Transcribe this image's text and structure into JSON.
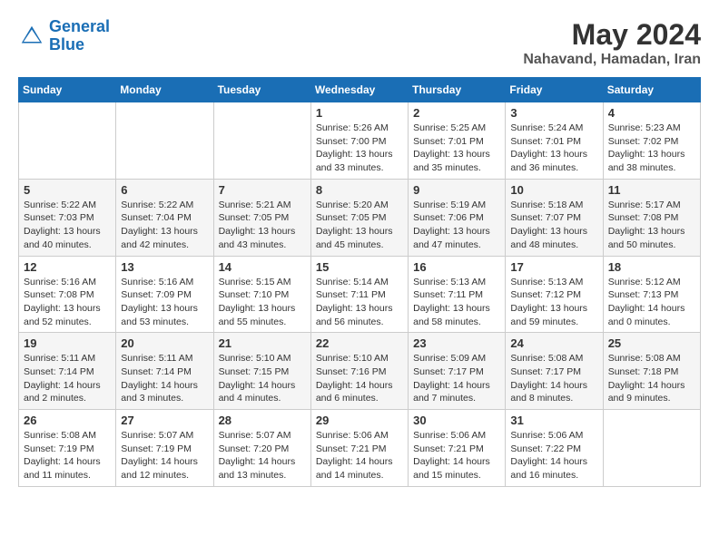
{
  "logo": {
    "line1": "General",
    "line2": "Blue"
  },
  "title": "May 2024",
  "location": "Nahavand, Hamadan, Iran",
  "days_of_week": [
    "Sunday",
    "Monday",
    "Tuesday",
    "Wednesday",
    "Thursday",
    "Friday",
    "Saturday"
  ],
  "weeks": [
    [
      {
        "day": "",
        "info": ""
      },
      {
        "day": "",
        "info": ""
      },
      {
        "day": "",
        "info": ""
      },
      {
        "day": "1",
        "info": "Sunrise: 5:26 AM\nSunset: 7:00 PM\nDaylight: 13 hours\nand 33 minutes."
      },
      {
        "day": "2",
        "info": "Sunrise: 5:25 AM\nSunset: 7:01 PM\nDaylight: 13 hours\nand 35 minutes."
      },
      {
        "day": "3",
        "info": "Sunrise: 5:24 AM\nSunset: 7:01 PM\nDaylight: 13 hours\nand 36 minutes."
      },
      {
        "day": "4",
        "info": "Sunrise: 5:23 AM\nSunset: 7:02 PM\nDaylight: 13 hours\nand 38 minutes."
      }
    ],
    [
      {
        "day": "5",
        "info": "Sunrise: 5:22 AM\nSunset: 7:03 PM\nDaylight: 13 hours\nand 40 minutes."
      },
      {
        "day": "6",
        "info": "Sunrise: 5:22 AM\nSunset: 7:04 PM\nDaylight: 13 hours\nand 42 minutes."
      },
      {
        "day": "7",
        "info": "Sunrise: 5:21 AM\nSunset: 7:05 PM\nDaylight: 13 hours\nand 43 minutes."
      },
      {
        "day": "8",
        "info": "Sunrise: 5:20 AM\nSunset: 7:05 PM\nDaylight: 13 hours\nand 45 minutes."
      },
      {
        "day": "9",
        "info": "Sunrise: 5:19 AM\nSunset: 7:06 PM\nDaylight: 13 hours\nand 47 minutes."
      },
      {
        "day": "10",
        "info": "Sunrise: 5:18 AM\nSunset: 7:07 PM\nDaylight: 13 hours\nand 48 minutes."
      },
      {
        "day": "11",
        "info": "Sunrise: 5:17 AM\nSunset: 7:08 PM\nDaylight: 13 hours\nand 50 minutes."
      }
    ],
    [
      {
        "day": "12",
        "info": "Sunrise: 5:16 AM\nSunset: 7:08 PM\nDaylight: 13 hours\nand 52 minutes."
      },
      {
        "day": "13",
        "info": "Sunrise: 5:16 AM\nSunset: 7:09 PM\nDaylight: 13 hours\nand 53 minutes."
      },
      {
        "day": "14",
        "info": "Sunrise: 5:15 AM\nSunset: 7:10 PM\nDaylight: 13 hours\nand 55 minutes."
      },
      {
        "day": "15",
        "info": "Sunrise: 5:14 AM\nSunset: 7:11 PM\nDaylight: 13 hours\nand 56 minutes."
      },
      {
        "day": "16",
        "info": "Sunrise: 5:13 AM\nSunset: 7:11 PM\nDaylight: 13 hours\nand 58 minutes."
      },
      {
        "day": "17",
        "info": "Sunrise: 5:13 AM\nSunset: 7:12 PM\nDaylight: 13 hours\nand 59 minutes."
      },
      {
        "day": "18",
        "info": "Sunrise: 5:12 AM\nSunset: 7:13 PM\nDaylight: 14 hours\nand 0 minutes."
      }
    ],
    [
      {
        "day": "19",
        "info": "Sunrise: 5:11 AM\nSunset: 7:14 PM\nDaylight: 14 hours\nand 2 minutes."
      },
      {
        "day": "20",
        "info": "Sunrise: 5:11 AM\nSunset: 7:14 PM\nDaylight: 14 hours\nand 3 minutes."
      },
      {
        "day": "21",
        "info": "Sunrise: 5:10 AM\nSunset: 7:15 PM\nDaylight: 14 hours\nand 4 minutes."
      },
      {
        "day": "22",
        "info": "Sunrise: 5:10 AM\nSunset: 7:16 PM\nDaylight: 14 hours\nand 6 minutes."
      },
      {
        "day": "23",
        "info": "Sunrise: 5:09 AM\nSunset: 7:17 PM\nDaylight: 14 hours\nand 7 minutes."
      },
      {
        "day": "24",
        "info": "Sunrise: 5:08 AM\nSunset: 7:17 PM\nDaylight: 14 hours\nand 8 minutes."
      },
      {
        "day": "25",
        "info": "Sunrise: 5:08 AM\nSunset: 7:18 PM\nDaylight: 14 hours\nand 9 minutes."
      }
    ],
    [
      {
        "day": "26",
        "info": "Sunrise: 5:08 AM\nSunset: 7:19 PM\nDaylight: 14 hours\nand 11 minutes."
      },
      {
        "day": "27",
        "info": "Sunrise: 5:07 AM\nSunset: 7:19 PM\nDaylight: 14 hours\nand 12 minutes."
      },
      {
        "day": "28",
        "info": "Sunrise: 5:07 AM\nSunset: 7:20 PM\nDaylight: 14 hours\nand 13 minutes."
      },
      {
        "day": "29",
        "info": "Sunrise: 5:06 AM\nSunset: 7:21 PM\nDaylight: 14 hours\nand 14 minutes."
      },
      {
        "day": "30",
        "info": "Sunrise: 5:06 AM\nSunset: 7:21 PM\nDaylight: 14 hours\nand 15 minutes."
      },
      {
        "day": "31",
        "info": "Sunrise: 5:06 AM\nSunset: 7:22 PM\nDaylight: 14 hours\nand 16 minutes."
      },
      {
        "day": "",
        "info": ""
      }
    ]
  ]
}
